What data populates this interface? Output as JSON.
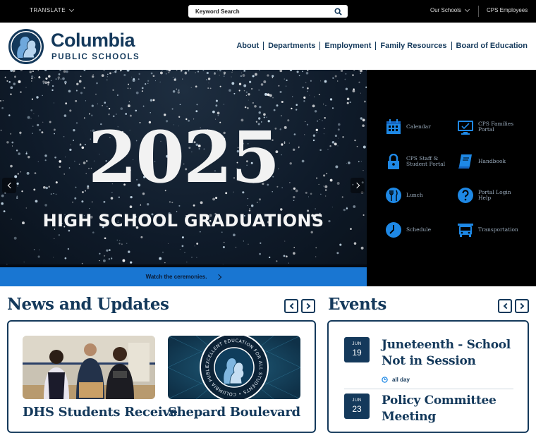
{
  "topbar": {
    "translate_label": "TRANSLATE",
    "search_placeholder": "Keyword Search",
    "our_schools_label": "Our Schools",
    "employees_label": "CPS Employees"
  },
  "header": {
    "logo_name": "Columbia",
    "logo_sub": "PUBLIC SCHOOLS",
    "nav": [
      "About",
      "Departments",
      "Employment",
      "Family Resources",
      "Board of Education"
    ]
  },
  "hero": {
    "year": "2025",
    "caption": "HIGH SCHOOL GRADUATIONS",
    "cta": "Watch the ceremonies."
  },
  "quick_links": [
    {
      "label": "Calendar",
      "icon": "calendar-icon"
    },
    {
      "label": "CPS Families Portal",
      "icon": "monitor-icon"
    },
    {
      "label": "CPS Staff & Student Portal",
      "icon": "lock-icon"
    },
    {
      "label": "Handbook",
      "icon": "book-icon"
    },
    {
      "label": "Lunch",
      "icon": "utensils-icon"
    },
    {
      "label": "Portal Login Help",
      "icon": "question-icon"
    },
    {
      "label": "Schedule",
      "icon": "clock-icon"
    },
    {
      "label": "Transportation",
      "icon": "bus-icon"
    }
  ],
  "news": {
    "title": "News and Updates",
    "items": [
      {
        "title": "DHS Students Receive"
      },
      {
        "title": "Shepard Boulevard",
        "seal_text": "EXCELLENT EDUCATION FOR ALL STUDENTS • COLUMBIA PUBLIC SCHOOLS"
      }
    ]
  },
  "events": {
    "title": "Events",
    "items": [
      {
        "month": "JUN",
        "day": "19",
        "title_line1": "Juneteenth - School",
        "title_line2": "Not in Session",
        "time": "all day"
      },
      {
        "month": "JUN",
        "day": "23",
        "title_line1": "Policy Committee",
        "title_line2": "Meeting"
      }
    ]
  },
  "colors": {
    "brand_navy": "#14395b",
    "accent_blue": "#1976d2",
    "icon_blue": "#1e88e5"
  }
}
